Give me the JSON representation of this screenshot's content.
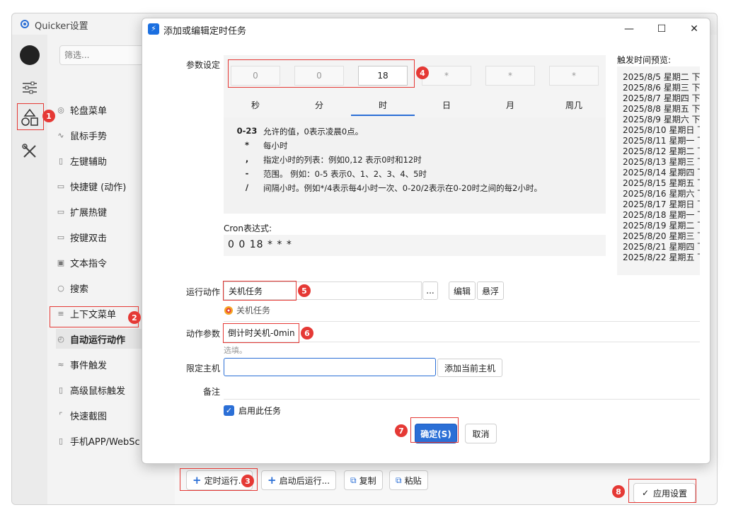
{
  "app": {
    "window_title": "Quicker设置"
  },
  "sidebar": {
    "filter_placeholder": "筛选...",
    "items": [
      {
        "label": "轮盘菜单"
      },
      {
        "label": "鼠标手势"
      },
      {
        "label": "左键辅助"
      },
      {
        "label": "快捷键 (动作)"
      },
      {
        "label": "扩展热键"
      },
      {
        "label": "按键双击"
      },
      {
        "label": "文本指令"
      },
      {
        "label": "搜索"
      },
      {
        "label": "上下文菜单"
      },
      {
        "label": "自动运行动作"
      },
      {
        "label": "事件触发"
      },
      {
        "label": "高级鼠标触发"
      },
      {
        "label": "快速截图"
      },
      {
        "label": "手机APP/WebSc"
      }
    ]
  },
  "toolbar": {
    "schedule_label": "定时运行...",
    "startup_label": "启动后运行...",
    "copy_label": "复制",
    "paste_label": "粘贴",
    "apply_label": "应用设置"
  },
  "dialog": {
    "title": "添加或编辑定时任务",
    "params_label": "参数设定",
    "cron_fields": [
      {
        "value": "0",
        "tab": "秒"
      },
      {
        "value": "0",
        "tab": "分"
      },
      {
        "value": "18",
        "tab": "时"
      },
      {
        "value": "*",
        "tab": "日"
      },
      {
        "value": "*",
        "tab": "月"
      },
      {
        "value": "*",
        "tab": "周几"
      }
    ],
    "help": [
      {
        "sym": "0-23",
        "text": "允许的值，0表示凌晨0点。"
      },
      {
        "sym": "*",
        "text": "每小时"
      },
      {
        "sym": ",",
        "text": "指定小时的列表：例如0,12 表示0时和12时"
      },
      {
        "sym": "-",
        "text": "范围。 例如：0-5 表示0、1、2、3、4、5时"
      },
      {
        "sym": "/",
        "text": "间隔小时。例如*/4表示每4小时一次、0-20/2表示在0-20时之间的每2小时。"
      }
    ],
    "cron_label": "Cron表达式:",
    "cron_expression": "0 0 18 * * *",
    "preview_label": "触发时间预览:",
    "preview": [
      "2025/8/5 星期二 下",
      "2025/8/6 星期三 下",
      "2025/8/7 星期四 下",
      "2025/8/8 星期五 下",
      "2025/8/9 星期六 下",
      "2025/8/10 星期日 下",
      "2025/8/11 星期一 下",
      "2025/8/12 星期二 下",
      "2025/8/13 星期三 下",
      "2025/8/14 星期四 下",
      "2025/8/15 星期五 下",
      "2025/8/16 星期六 下",
      "2025/8/17 星期日 下",
      "2025/8/18 星期一 下",
      "2025/8/19 星期二 下",
      "2025/8/20 星期三 下",
      "2025/8/21 星期四 下",
      "2025/8/22 星期五 下"
    ],
    "action_label": "运行动作",
    "action_value": "关机任务",
    "action_more": "...",
    "edit_label": "编辑",
    "float_label": "悬浮",
    "action_name": "关机任务",
    "action_params_label": "动作参数",
    "action_params_value": "倒计时关机-0min",
    "optional_hint": "选填。",
    "host_label": "限定主机",
    "host_value": "",
    "add_host_label": "添加当前主机",
    "note_label": "备注",
    "enable_label": "启用此任务",
    "confirm_label": "确定(S)",
    "cancel_label": "取消"
  },
  "annotations": [
    "1",
    "2",
    "3",
    "4",
    "5",
    "6",
    "7",
    "8"
  ],
  "colors": {
    "accent": "#2b6fd6",
    "highlight": "#e53935"
  }
}
